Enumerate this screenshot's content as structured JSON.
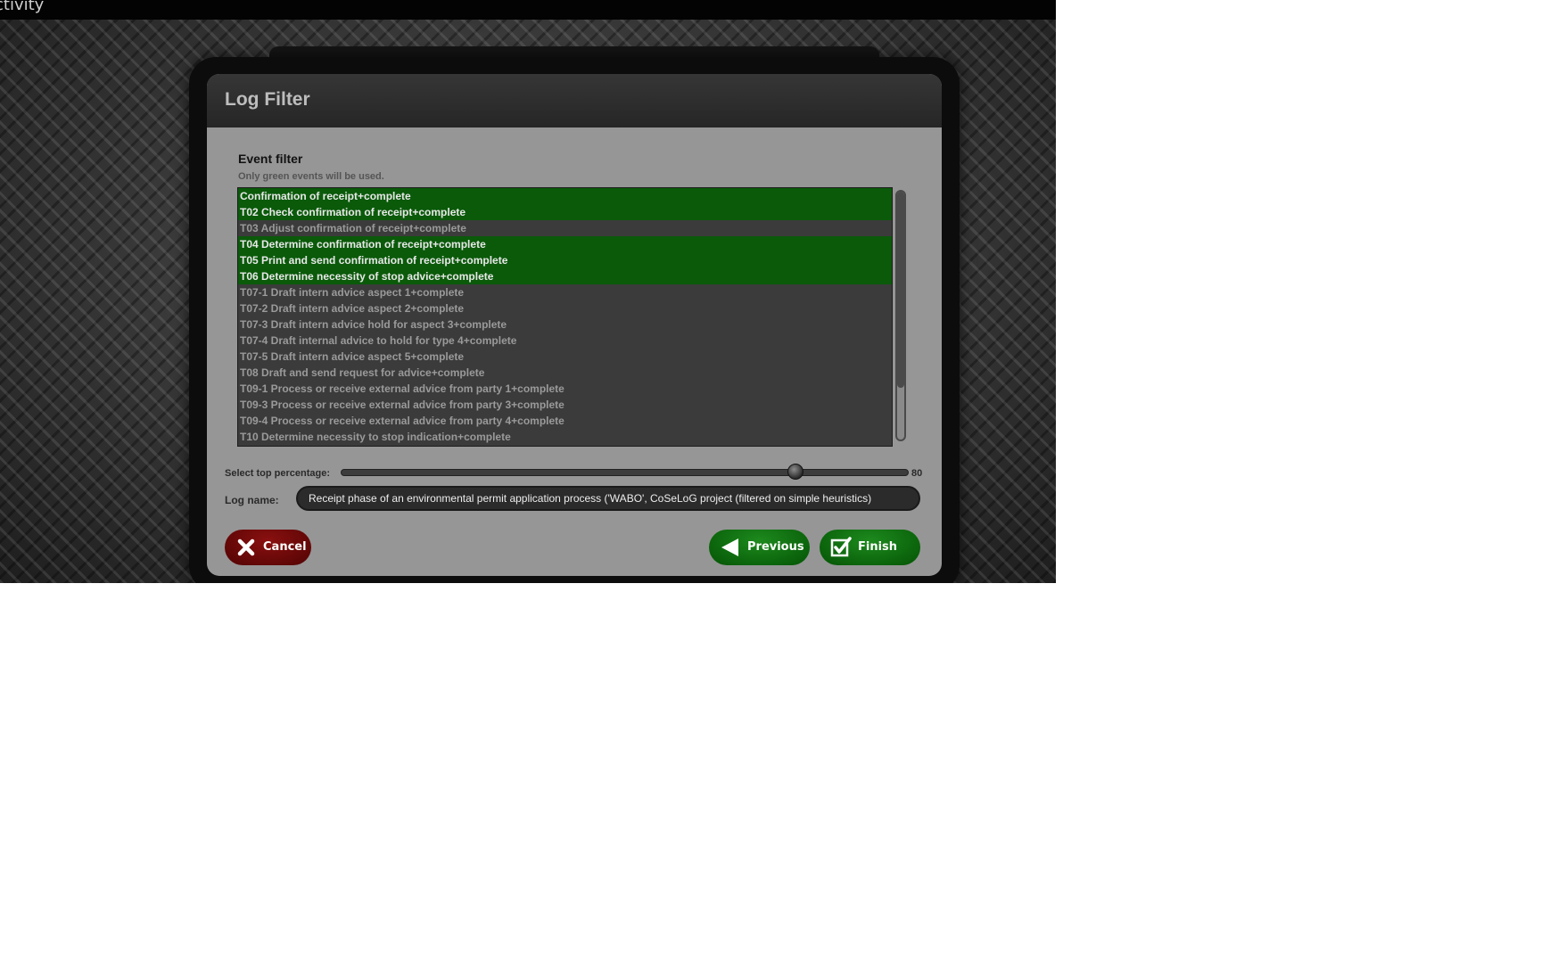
{
  "app": {
    "title": "ctivity"
  },
  "dialog": {
    "title": "Log Filter"
  },
  "event_filter": {
    "heading": "Event filter",
    "hint": "Only green events will be used.",
    "events": [
      {
        "label": "Confirmation of receipt+complete",
        "selected": true
      },
      {
        "label": "T02 Check confirmation of receipt+complete",
        "selected": true
      },
      {
        "label": "T03 Adjust confirmation of receipt+complete",
        "selected": false
      },
      {
        "label": "T04 Determine confirmation of receipt+complete",
        "selected": true
      },
      {
        "label": "T05 Print and send confirmation of receipt+complete",
        "selected": true
      },
      {
        "label": "T06 Determine necessity of stop advice+complete",
        "selected": true
      },
      {
        "label": "T07-1 Draft intern advice aspect 1+complete",
        "selected": false
      },
      {
        "label": "T07-2 Draft intern advice aspect 2+complete",
        "selected": false
      },
      {
        "label": "T07-3 Draft intern advice hold for aspect 3+complete",
        "selected": false
      },
      {
        "label": "T07-4 Draft internal advice to hold for type 4+complete",
        "selected": false
      },
      {
        "label": "T07-5 Draft intern advice aspect 5+complete",
        "selected": false
      },
      {
        "label": "T08 Draft and send request for advice+complete",
        "selected": false
      },
      {
        "label": "T09-1 Process or receive external advice from party 1+complete",
        "selected": false
      },
      {
        "label": "T09-3 Process or receive external advice from party 3+complete",
        "selected": false
      },
      {
        "label": "T09-4 Process or receive external advice from party 4+complete",
        "selected": false
      },
      {
        "label": "T10 Determine necessity to stop indication+complete",
        "selected": false
      }
    ]
  },
  "percentage": {
    "label": "Select top percentage:",
    "value": "80",
    "fraction": 0.8
  },
  "log_name": {
    "label": "Log name:",
    "value": "Receipt phase of an environmental permit application process ('WABO', CoSeLoG project (filtered on simple heuristics)"
  },
  "buttons": {
    "cancel": "Cancel",
    "previous": "Previous",
    "finish": "Finish"
  },
  "colors": {
    "selected_event": "#0a5a0a",
    "cancel": "#6d0909",
    "confirm": "#0b6a0b"
  },
  "icons": {
    "cancel": "close-icon",
    "previous": "arrow-left-icon",
    "finish": "checkbox-check-icon"
  }
}
